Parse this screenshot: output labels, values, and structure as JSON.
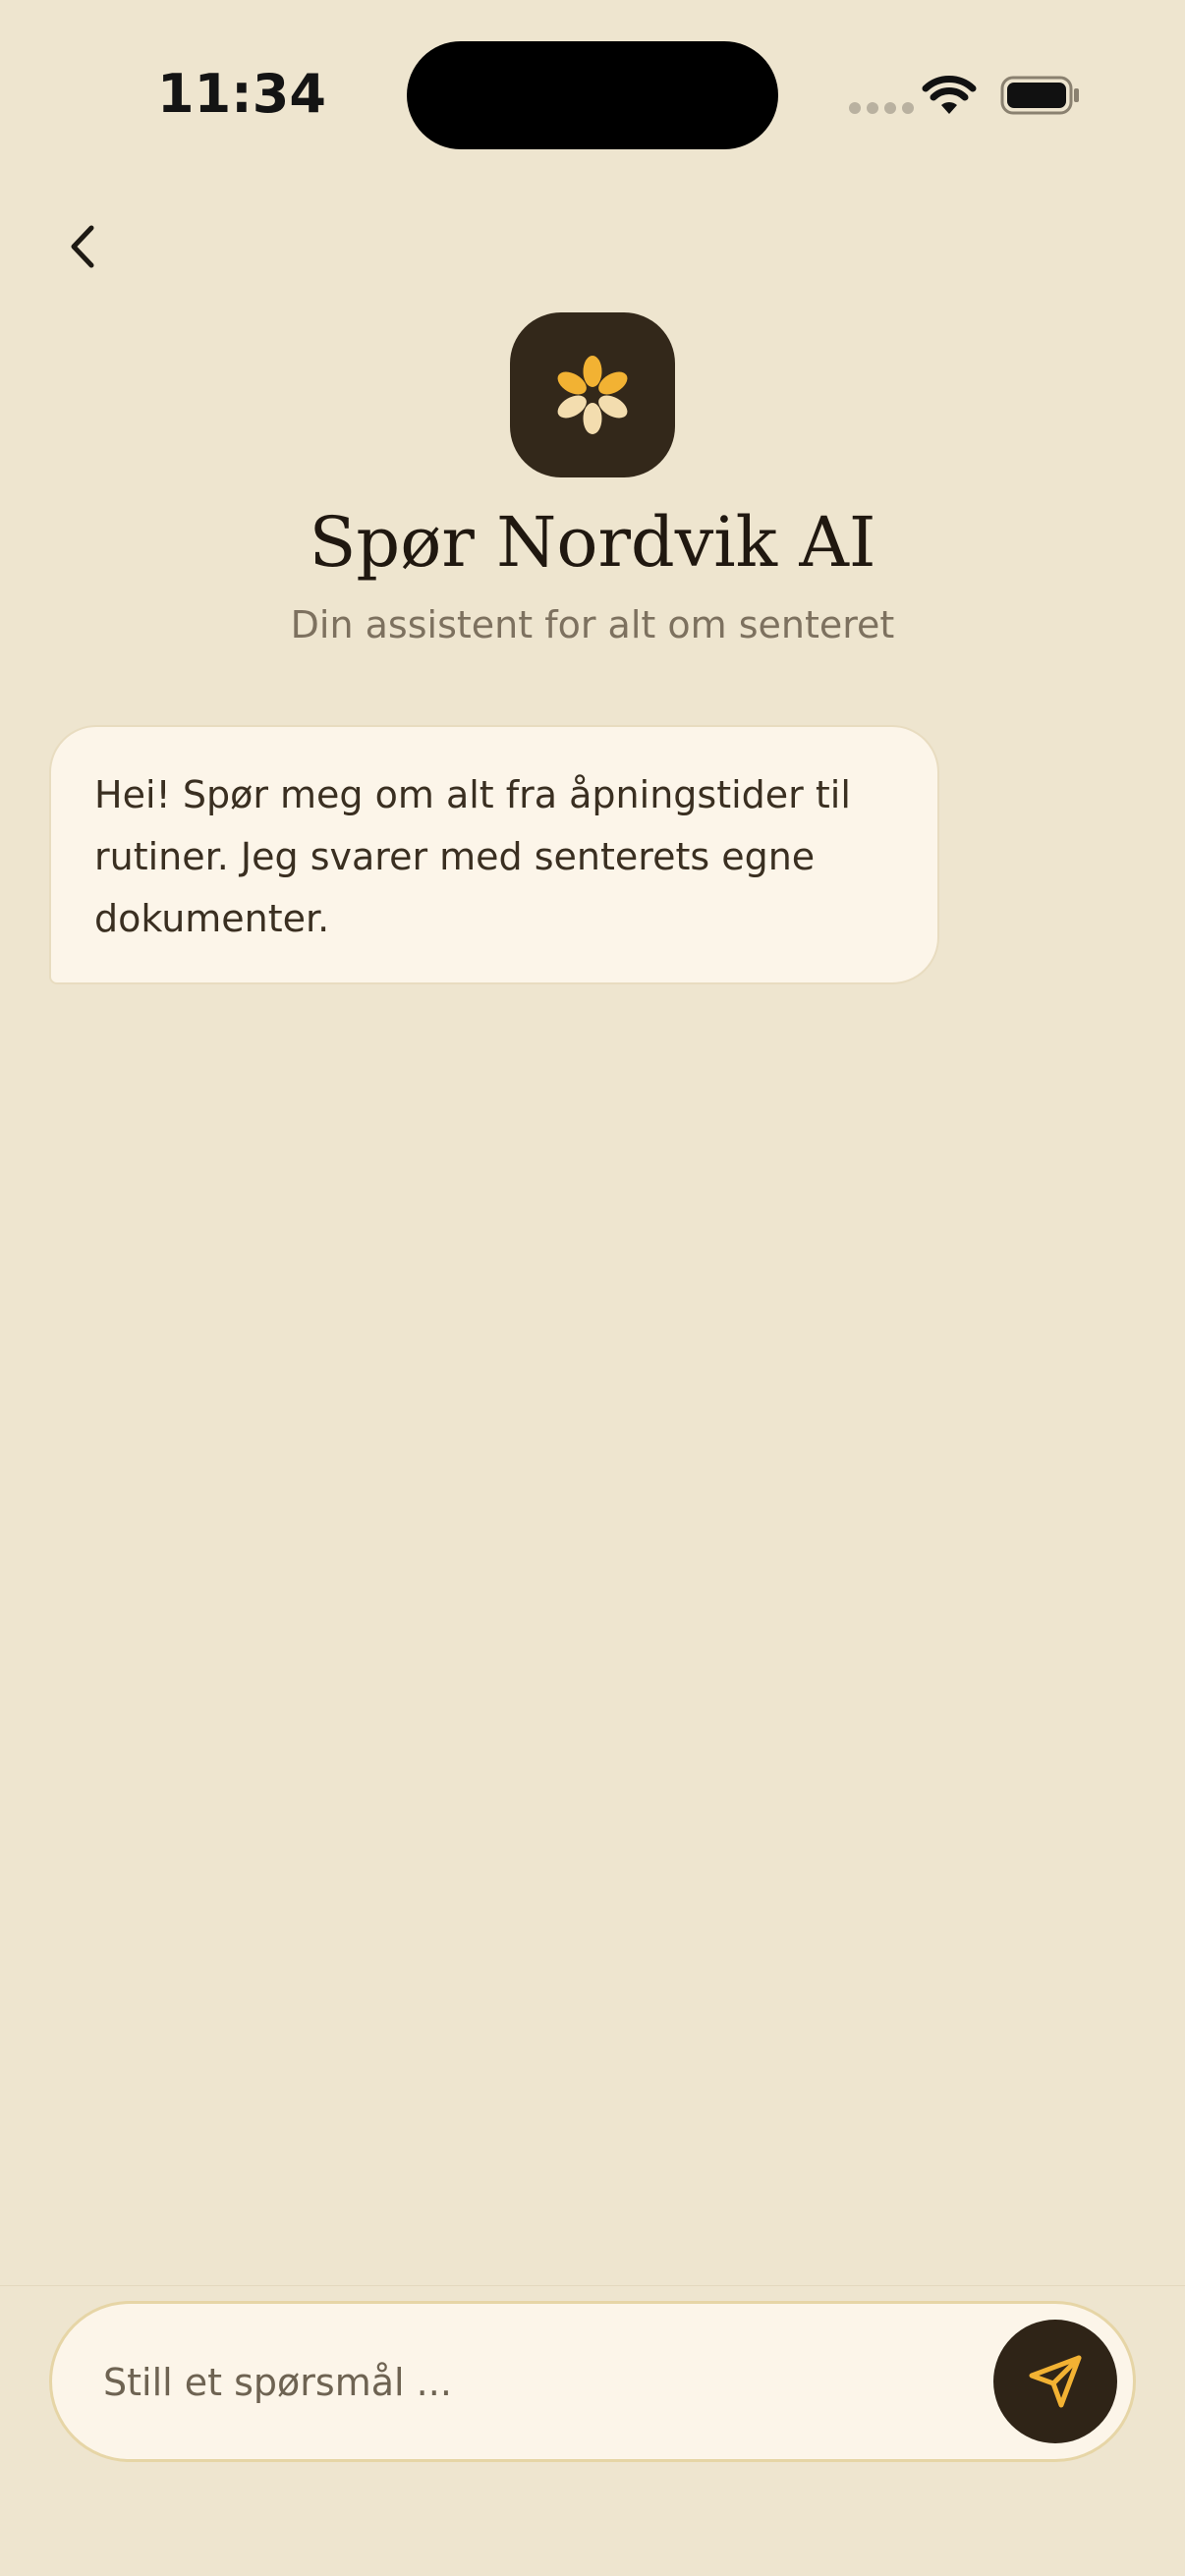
{
  "status_bar": {
    "time": "11:34",
    "icons": [
      "signal-dots-icon",
      "wifi-icon",
      "battery-icon"
    ]
  },
  "nav": {
    "back_icon": "chevron-left-icon"
  },
  "header": {
    "logo_icon": "flower-icon",
    "title": "Spør Nordvik AI",
    "subtitle": "Din assistent for alt om senteret"
  },
  "chat": {
    "messages": [
      {
        "role": "assistant",
        "text": "Hei! Spør meg om alt fra åpningstider til rutiner. Jeg svarer med senterets egne dokumenter."
      }
    ]
  },
  "composer": {
    "placeholder": "Still et spørsmål ...",
    "value": "",
    "send_icon": "send-icon"
  },
  "colors": {
    "background": "#EEE5CF",
    "bubble": "#FCF5E9",
    "dark": "#33281A",
    "accent": "#F2B233"
  }
}
